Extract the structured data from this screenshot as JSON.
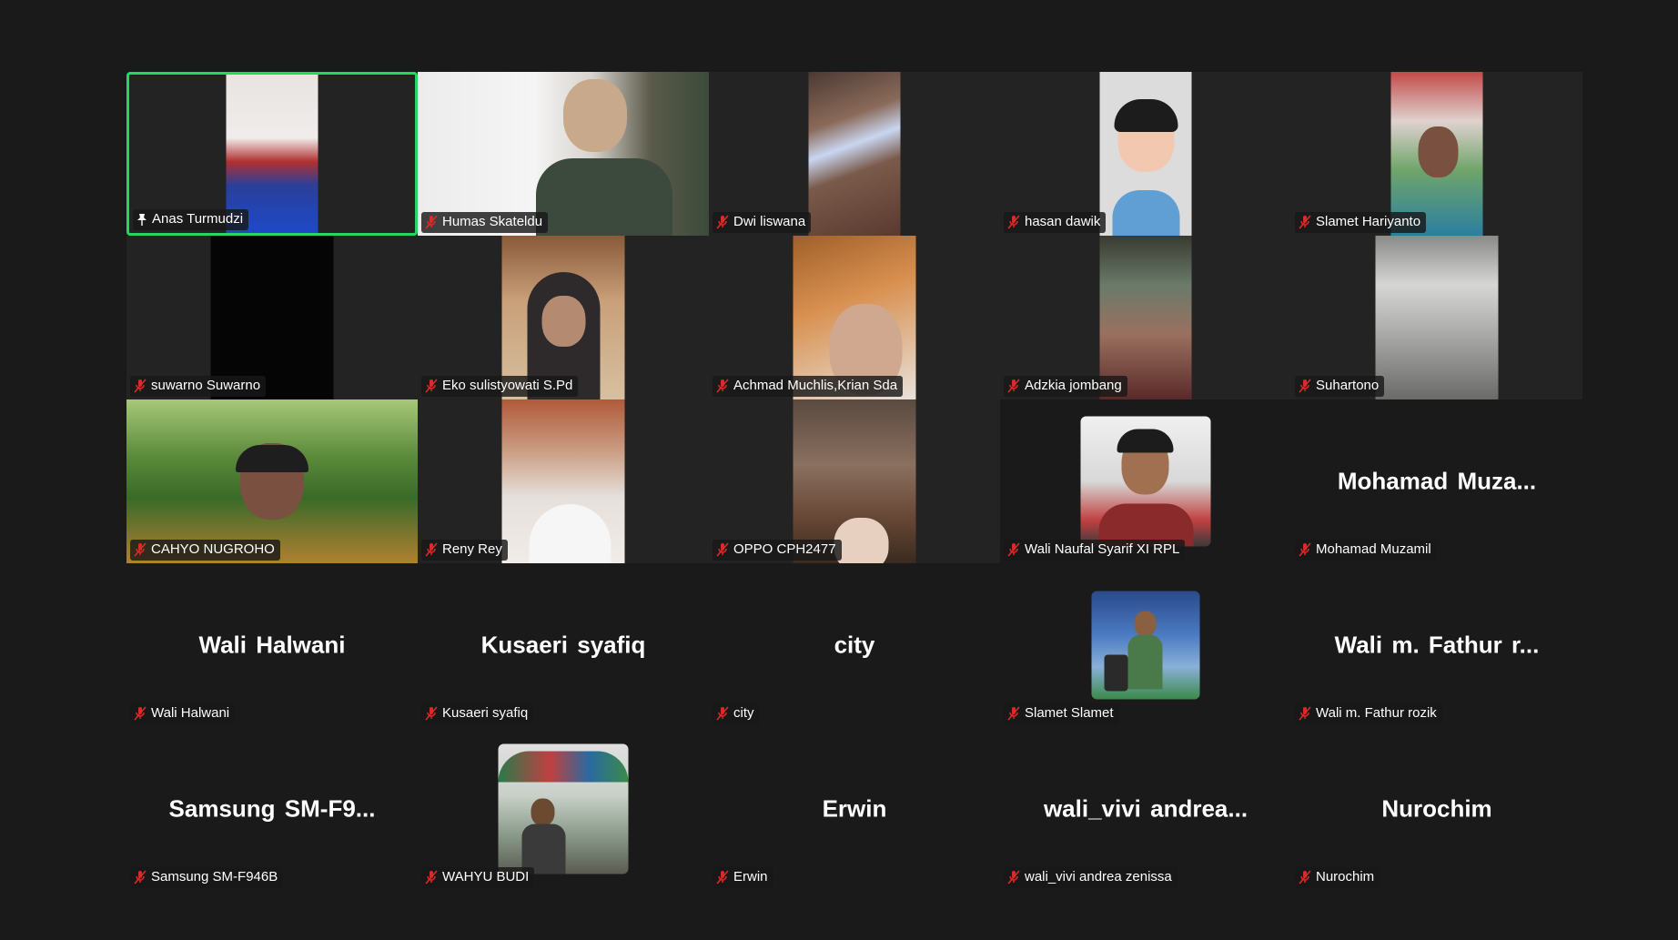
{
  "colors": {
    "background": "#1a1a1a",
    "tile_dark": "#232323",
    "active_speaker_border": "#23d959",
    "muted_icon": "#e02828"
  },
  "participants": [
    {
      "name": "Anas Turmudzi",
      "icon": "pin-icon",
      "view": "video",
      "active": true
    },
    {
      "name": "Humas Skateldu",
      "icon": "muted-mic-icon",
      "view": "video"
    },
    {
      "name": "Dwi liswana",
      "icon": "muted-mic-icon",
      "view": "video"
    },
    {
      "name": "hasan dawik",
      "icon": "muted-mic-icon",
      "view": "video"
    },
    {
      "name": "Slamet Hariyanto",
      "icon": "muted-mic-icon",
      "view": "video"
    },
    {
      "name": "suwarno Suwarno",
      "icon": "muted-mic-icon",
      "view": "video"
    },
    {
      "name": "Eko sulistyowati S.Pd",
      "icon": "muted-mic-icon",
      "view": "video"
    },
    {
      "name": "Achmad Muchlis,Krian Sda",
      "icon": "muted-mic-icon",
      "view": "video"
    },
    {
      "name": "Adzkia jombang",
      "icon": "muted-mic-icon",
      "view": "video"
    },
    {
      "name": "Suhartono",
      "icon": "muted-mic-icon",
      "view": "video"
    },
    {
      "name": "CAHYO NUGROHO",
      "icon": "muted-mic-icon",
      "view": "video"
    },
    {
      "name": "Reny Rey",
      "icon": "muted-mic-icon",
      "view": "video"
    },
    {
      "name": "OPPO CPH2477",
      "icon": "muted-mic-icon",
      "view": "video"
    },
    {
      "name": "Wali Naufal Syarif XI RPL",
      "icon": "muted-mic-icon",
      "view": "avatar"
    },
    {
      "name": "Mohamad Muzamil",
      "display": "Mohamad  Muza...",
      "icon": "muted-mic-icon",
      "view": "name"
    },
    {
      "name": "Wali Halwani",
      "display": "Wali Halwani",
      "icon": "muted-mic-icon",
      "view": "name"
    },
    {
      "name": "Kusaeri syafiq",
      "display": "Kusaeri syafiq",
      "icon": "muted-mic-icon",
      "view": "name"
    },
    {
      "name": "city",
      "display": "city",
      "icon": "muted-mic-icon",
      "view": "name"
    },
    {
      "name": "Slamet Slamet",
      "icon": "muted-mic-icon",
      "view": "avatar"
    },
    {
      "name": "Wali m. Fathur rozik",
      "display": "Wali m. Fathur r...",
      "icon": "muted-mic-icon",
      "view": "name"
    },
    {
      "name": "Samsung SM-F946B",
      "display": "Samsung  SM-F9...",
      "icon": "muted-mic-icon",
      "view": "name"
    },
    {
      "name": "WAHYU BUDI",
      "icon": "muted-mic-icon",
      "view": "avatar"
    },
    {
      "name": "Erwin",
      "display": "Erwin",
      "icon": "muted-mic-icon",
      "view": "name"
    },
    {
      "name": "wali_vivi andrea zenissa",
      "display": "wali_vivi  andrea...",
      "icon": "muted-mic-icon",
      "view": "name"
    },
    {
      "name": "Nurochim",
      "display": "Nurochim",
      "icon": "muted-mic-icon",
      "view": "name"
    }
  ]
}
